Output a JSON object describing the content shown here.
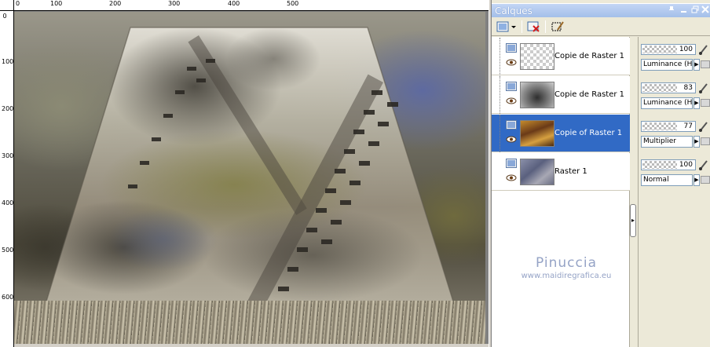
{
  "ruler": {
    "top_labels": [
      "0",
      "100",
      "200",
      "300",
      "400",
      "500"
    ],
    "left_labels": [
      "0",
      "100",
      "200",
      "300",
      "400",
      "500",
      "600"
    ]
  },
  "panel": {
    "title": "Calques",
    "title_buttons": [
      "pin-icon",
      "minimize-icon",
      "restore-icon",
      "close-icon"
    ]
  },
  "toolbar": {
    "buttons": [
      "new-layer-icon",
      "delete-layer-icon",
      "edit-selection-icon"
    ]
  },
  "layers": [
    {
      "name": "Copie de Raster 1",
      "opacity": "100",
      "blend": "Luminance (H)",
      "thumb": "transparent",
      "selected": false
    },
    {
      "name": "Copie de Raster 1",
      "opacity": "83",
      "blend": "Luminance (H)",
      "thumb": "grey",
      "selected": false
    },
    {
      "name": "Copie of Raster 1",
      "opacity": "77",
      "blend": "Multiplier",
      "thumb": "gold",
      "selected": true
    },
    {
      "name": "Raster 1",
      "opacity": "100",
      "blend": "Normal",
      "thumb": "blue",
      "selected": false
    }
  ],
  "watermark": {
    "name": "Pinuccia",
    "url": "www.maidiregrafica.eu"
  },
  "colors": {
    "selection": "#316ac5",
    "title_bar": "#a4bfe9",
    "panel_bg": "#ece9d8"
  }
}
